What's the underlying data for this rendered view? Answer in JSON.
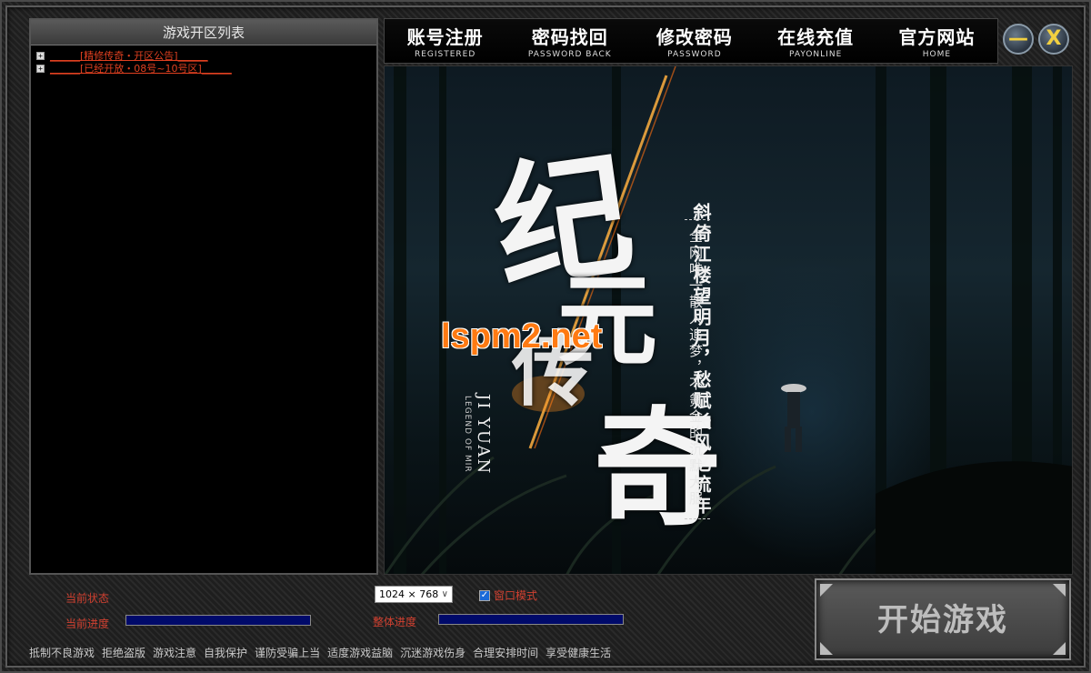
{
  "server_list": {
    "title": "游戏开区列表",
    "items": [
      {
        "text": "______[精修传奇・开区公告]______"
      },
      {
        "text": "______[已经开放・08号~10号区]______"
      }
    ]
  },
  "nav": [
    {
      "cn": "账号注册",
      "en": "REGISTERED"
    },
    {
      "cn": "密码找回",
      "en": "PASSWORD BACK"
    },
    {
      "cn": "修改密码",
      "en": "PASSWORD"
    },
    {
      "cn": "在线充值",
      "en": "PAYONLINE"
    },
    {
      "cn": "官方网站",
      "en": "HOME"
    }
  ],
  "window": {
    "minimize": "—",
    "close": "X"
  },
  "banner": {
    "title_chars": [
      "纪",
      "元",
      "传",
      "奇"
    ],
    "english": "JI YUAN",
    "english_sub": "LEGEND OF MIR",
    "watermark": "lspm2.net",
    "slogan_main": "斜倚江楼望明月，愁赋长风忆流年",
    "slogan_sub": "全网唯一散人追梦，不氪金的沉默大服"
  },
  "controls": {
    "status_label": "当前状态",
    "progress_label": "当前进度",
    "overall_label": "整体进度",
    "current_progress": 0,
    "overall_progress": 0,
    "resolution": "1024 × 768",
    "window_mode_label": "窗口模式",
    "window_mode_checked": true,
    "start_label": "开始游戏"
  },
  "warnings": [
    "抵制不良游戏",
    "拒绝盗版",
    "游戏注意",
    "自我保护",
    "谨防受骗上当",
    "适度游戏益脑",
    "沉迷游戏伤身",
    "合理安排时间",
    "享受健康生活"
  ],
  "colors": {
    "label_red": "#d04030",
    "link_red": "#e04020",
    "watermark_orange": "#ff7a12",
    "progress_blue": "#000a6a"
  }
}
